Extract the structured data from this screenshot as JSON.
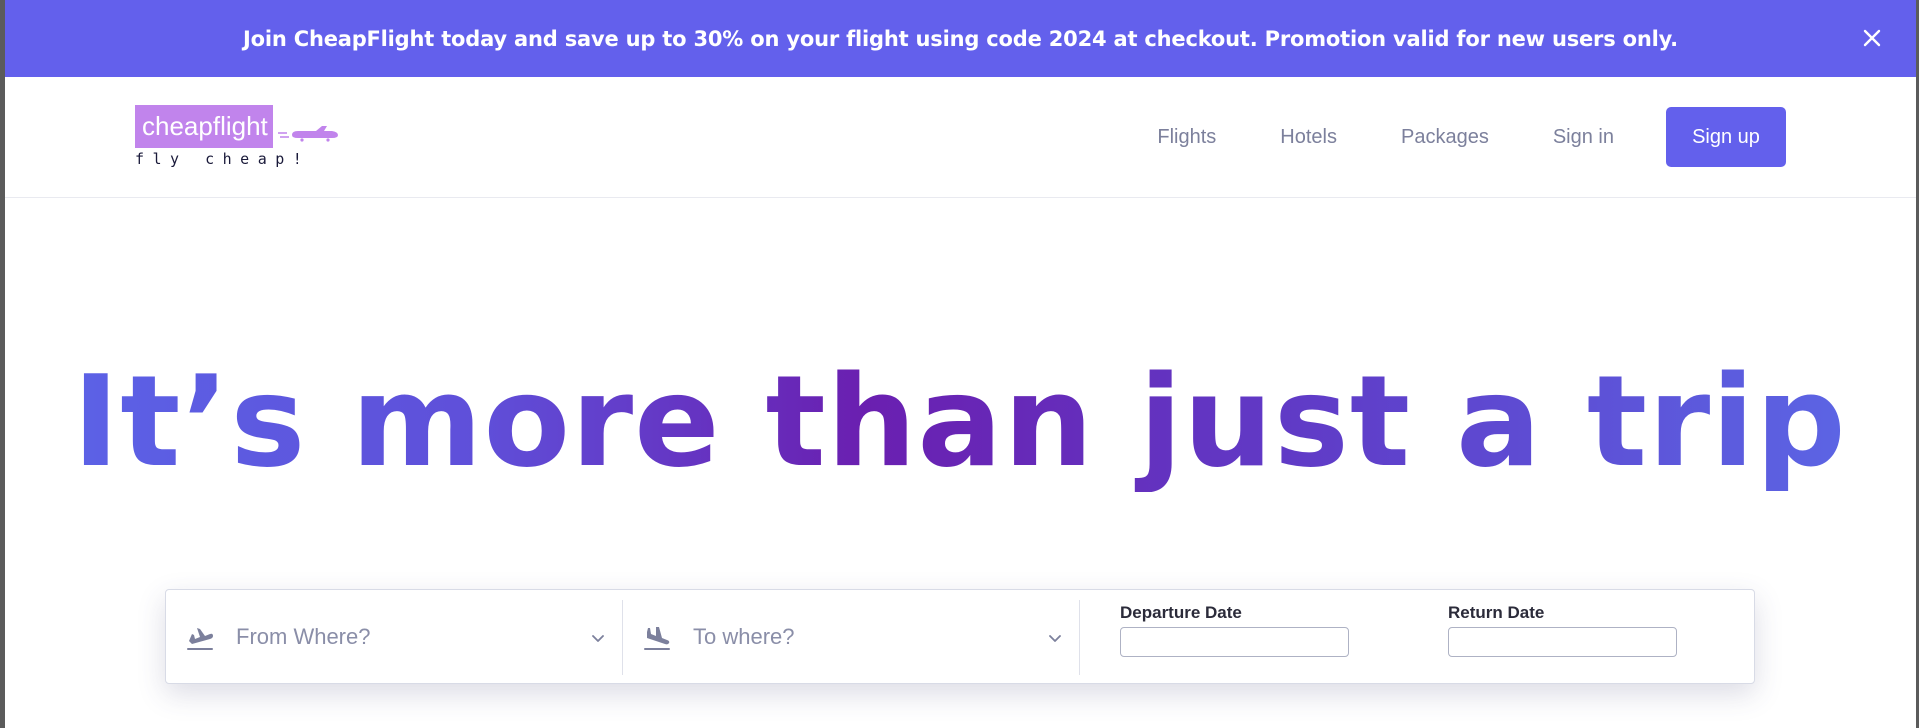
{
  "promo": {
    "text": "Join CheapFlight today and save up to 30% on your flight using code 2024 at checkout. Promotion valid for new users only.",
    "close_icon": "close-icon",
    "background": "#6360ec"
  },
  "header": {
    "logo": {
      "name": "cheapflight",
      "tagline": "fly cheap!",
      "icon": "airplane-icon",
      "color": "#c184ec"
    },
    "nav": {
      "flights": "Flights",
      "hotels": "Hotels",
      "packages": "Packages",
      "signin": "Sign in",
      "signup": "Sign up"
    }
  },
  "hero": {
    "title": "It’s more than just a trip"
  },
  "search": {
    "from": {
      "placeholder": "From Where?",
      "icon": "takeoff-icon"
    },
    "to": {
      "placeholder": "To where?",
      "icon": "landing-icon"
    },
    "departure_label": "Departure Date",
    "return_label": "Return Date",
    "departure_value": "",
    "return_value": ""
  },
  "colors": {
    "accent": "#6360ec",
    "nav_text": "#7c809c",
    "placeholder": "#8a8ea8"
  }
}
